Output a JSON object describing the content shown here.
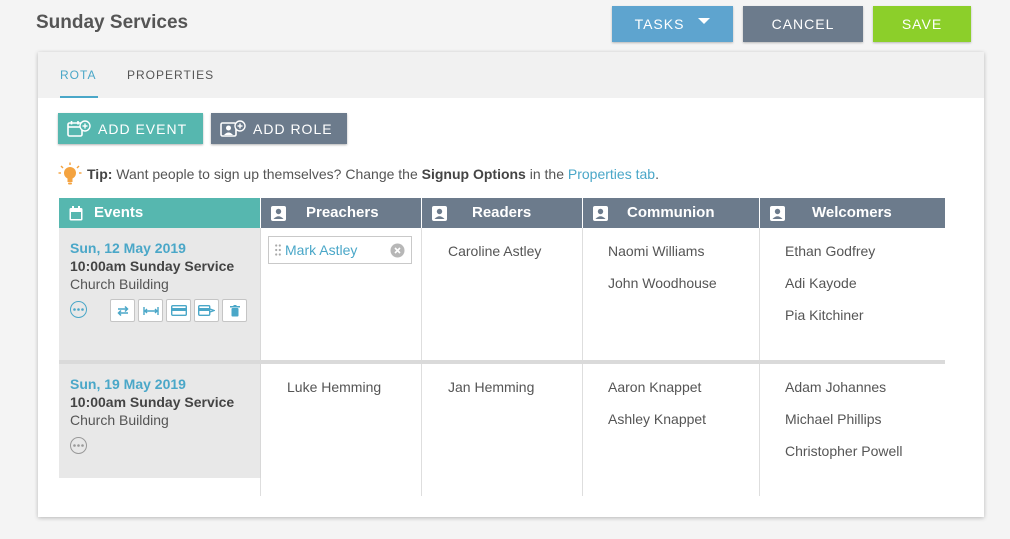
{
  "header": {
    "title": "Sunday Services",
    "tasks_label": "TASKS",
    "cancel_label": "CANCEL",
    "save_label": "SAVE"
  },
  "tabs": [
    {
      "label": "ROTA",
      "active": true
    },
    {
      "label": "PROPERTIES",
      "active": false
    }
  ],
  "actions": {
    "add_event_label": "ADD EVENT",
    "add_role_label": "ADD ROLE"
  },
  "tip": {
    "lead": "Tip:",
    "text1": " Want people to sign up themselves? Change the ",
    "bold": "Signup Options",
    "text2": " in the ",
    "link": "Properties tab",
    "end": "."
  },
  "columns": {
    "events": "Events",
    "roles": [
      "Preachers",
      "Readers",
      "Communion",
      "Welcomers"
    ]
  },
  "events": [
    {
      "date": "Sun, 12 May 2019",
      "time": "10:00am Sunday Service",
      "location": "Church Building",
      "assignments": {
        "preachers": [
          "Mark Astley"
        ],
        "readers": [
          "Caroline Astley"
        ],
        "communion": [
          "Naomi Williams",
          "John Woodhouse"
        ],
        "welcomers": [
          "Ethan Godfrey",
          "Adi Kayode",
          "Pia Kitchiner"
        ]
      }
    },
    {
      "date": "Sun, 19 May 2019",
      "time": "10:00am Sunday Service",
      "location": "Church Building",
      "assignments": {
        "preachers": [
          "Luke Hemming"
        ],
        "readers": [
          "Jan Hemming"
        ],
        "communion": [
          "Aaron Knappet",
          "Ashley Knappet"
        ],
        "welcomers": [
          "Adam Johannes",
          "Michael Phillips",
          "Christopher Powell"
        ]
      }
    }
  ],
  "icons": {
    "tasks": "chevron-down-icon",
    "add_event": "calendar-plus-icon",
    "add_role": "user-plus-icon",
    "tip": "lightbulb-icon",
    "events_header": "calendar-icon",
    "role_header": "person-badge-icon",
    "event_more": "ellipsis-circle-icon",
    "event_tools": [
      "swap-icon",
      "width-icon",
      "card-icon",
      "label-icon",
      "trash-icon"
    ],
    "chip_remove": "close-circle-icon",
    "chip_drag": "drag-handle-icon"
  },
  "colors": {
    "accent_teal": "#56b7af",
    "accent_blue": "#4aa7c8",
    "tasks_blue": "#5ea4cf",
    "slate": "#6c7b8c",
    "save_green": "#8ccf2a",
    "tip_orange": "#f4a340"
  }
}
